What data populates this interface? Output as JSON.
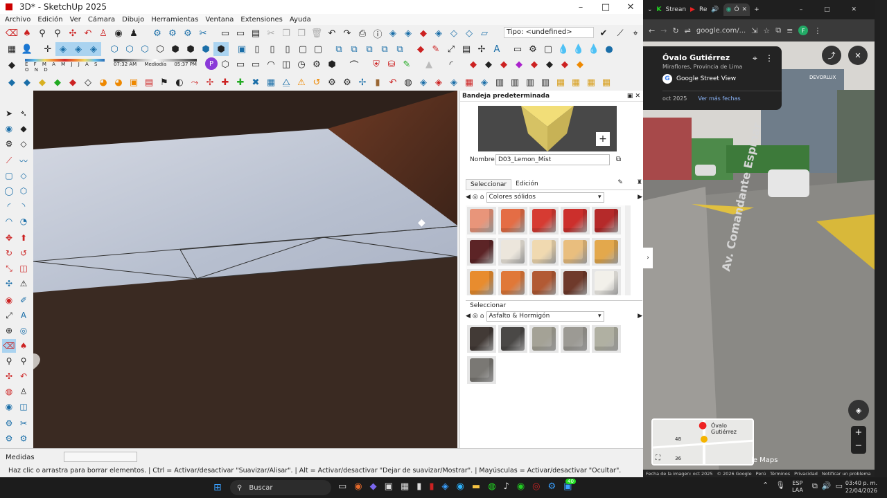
{
  "su": {
    "title": "3D* - SketchUp 2025",
    "menu": [
      "Archivo",
      "Edición",
      "Ver",
      "Cámara",
      "Dibujo",
      "Herramientas",
      "Ventana",
      "Extensiones",
      "Ayuda"
    ],
    "type_field": "Tipo: <undefined>",
    "months": "E F M A M J J A S O N D",
    "time_start": "07:32 AM",
    "time_mid": "Mediodía",
    "time_end": "05:37 PM",
    "measures_label": "Medidas",
    "status_text": "Haz clic o arrastra para borrar elementos. | Ctrl = Activar/desactivar \"Suavizar/Alisar\". | Alt = Activar/desactivar \"Dejar de suavizar/Mostrar\". | Mayúsculas = Activar/desactivar \"Ocultar\"."
  },
  "tray": {
    "title": "Bandeja predeterminada",
    "name_label": "Nombre",
    "name_value": "D03_Lemon_Mist",
    "tab_select": "Seleccionar",
    "tab_edit": "Edición",
    "library1": "Colores sólidos",
    "select2": "Seleccionar",
    "library2": "Asfalto & Hormigón",
    "colors1": [
      "#e8957a",
      "#e46d45",
      "#d63b32",
      "#cc2f2c",
      "#b52a2a",
      "#5c2426",
      "#ece6dc",
      "#f0d9b0",
      "#e9be7e",
      "#e3a84c",
      "#e88c2e",
      "#e07838",
      "#b25a34",
      "#6f3a2b",
      "#f2f0ea"
    ],
    "colors2": [
      "#423a36",
      "#4a4846",
      "#a4a296",
      "#9c9a94",
      "#b0b0a2",
      "#7a7874"
    ]
  },
  "chrome": {
    "tab1": "Strean",
    "tab2": "Re",
    "tab3": "Ó",
    "url": "google.com/...",
    "profile": "F",
    "place_title": "Óvalo Gutiérrez",
    "place_sub": "Miraflores, Provincia de Lima",
    "sv_label": "Google Street View",
    "date": "oct 2025",
    "more_dates": "Ver más fechas",
    "street_sign": "Av. Comandante Espinar",
    "map_label": "Óvalo Gutiérrez",
    "map_n1": "48",
    "map_n2": "36",
    "maps_text": "le Maps",
    "footer": [
      "Fecha de la imagen: oct 2025",
      "© 2026 Google",
      "Perú",
      "Términos",
      "Privacidad",
      "Notificar un problema"
    ],
    "building_text": "DEVORLUX"
  },
  "taskbar": {
    "search": "Buscar",
    "lang1": "ESP",
    "lang2": "LAA",
    "time": "03:40 p. m.",
    "date": "22/04/2026",
    "badge": "40"
  }
}
